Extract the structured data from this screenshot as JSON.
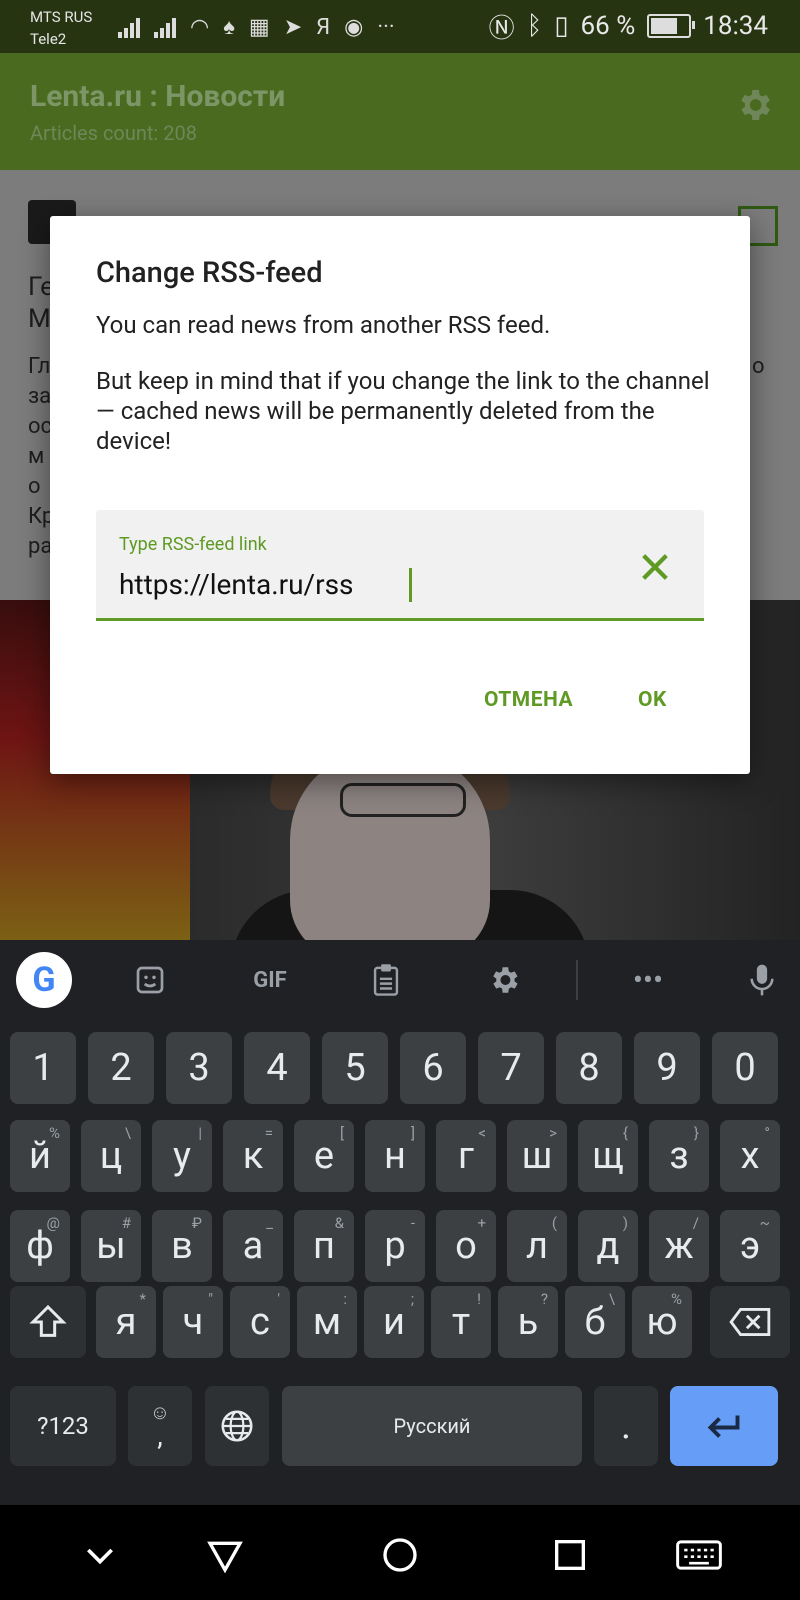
{
  "status_bar": {
    "carrier_1": "MTS RUS",
    "carrier_2": "Tele2",
    "battery_percent": "66 %",
    "time": "18:34",
    "notification_icons": [
      "signal-icon",
      "signal-icon",
      "wifi-icon",
      "tor-icon",
      "news-icon",
      "telegram-icon",
      "yandex-icon",
      "yandex-browser-icon",
      "more-icon"
    ]
  },
  "app_bar": {
    "title": "Lenta.ru : Новости",
    "articles_count": "Articles count: 208"
  },
  "background_article": {
    "headline_lines": [
      "Ге",
      "М"
    ],
    "body_lines": [
      "Гл",
      "за",
      "ос",
      "м",
      "о",
      "Кр",
      "ра"
    ],
    "body_right_fragment": "о"
  },
  "dialog": {
    "title": "Change RSS-feed",
    "message_1": "You can read news from another RSS feed.",
    "message_2": "But keep in mind that if you change the link to the channel — cached news will be permanently deleted from the device!",
    "field_label": "Type RSS-feed link",
    "field_value": "https://lenta.ru/rss",
    "cancel_label": "ОТМЕНА",
    "ok_label": "OK"
  },
  "keyboard": {
    "toolbar": [
      "sticker-icon",
      "GIF",
      "clipboard-icon",
      "gear-icon",
      "more-icon",
      "mic-icon"
    ],
    "gif_label": "GIF",
    "digits": [
      "1",
      "2",
      "3",
      "4",
      "5",
      "6",
      "7",
      "8",
      "9",
      "0"
    ],
    "row1": [
      {
        "k": "й",
        "h": "%"
      },
      {
        "k": "ц",
        "h": "\\"
      },
      {
        "k": "у",
        "h": "|"
      },
      {
        "k": "к",
        "h": "="
      },
      {
        "k": "е",
        "h": "["
      },
      {
        "k": "н",
        "h": "]"
      },
      {
        "k": "г",
        "h": "<"
      },
      {
        "k": "ш",
        "h": ">"
      },
      {
        "k": "щ",
        "h": "{"
      },
      {
        "k": "з",
        "h": "}"
      },
      {
        "k": "х",
        "h": "°"
      }
    ],
    "row2": [
      {
        "k": "ф",
        "h": "@"
      },
      {
        "k": "ы",
        "h": "#"
      },
      {
        "k": "в",
        "h": "₽"
      },
      {
        "k": "а",
        "h": "_"
      },
      {
        "k": "п",
        "h": "&"
      },
      {
        "k": "р",
        "h": "-"
      },
      {
        "k": "о",
        "h": "+"
      },
      {
        "k": "л",
        "h": "("
      },
      {
        "k": "д",
        "h": ")"
      },
      {
        "k": "ж",
        "h": "/"
      },
      {
        "k": "э",
        "h": "~"
      }
    ],
    "row3": [
      {
        "k": "я",
        "h": "*"
      },
      {
        "k": "ч",
        "h": "\""
      },
      {
        "k": "с",
        "h": "'"
      },
      {
        "k": "м",
        "h": ":"
      },
      {
        "k": "и",
        "h": ";"
      },
      {
        "k": "т",
        "h": "!"
      },
      {
        "k": "ь",
        "h": "?"
      },
      {
        "k": "б",
        "h": "\\"
      },
      {
        "k": "ю",
        "h": "%"
      }
    ],
    "symbols_key": "?123",
    "comma_key": ",",
    "emoji_hint": "☺",
    "space_label": "Русский",
    "period_key": "."
  },
  "colors": {
    "accent": "#5f9a24",
    "app_bar": "#4a6b1f",
    "enter_key": "#669df6"
  }
}
